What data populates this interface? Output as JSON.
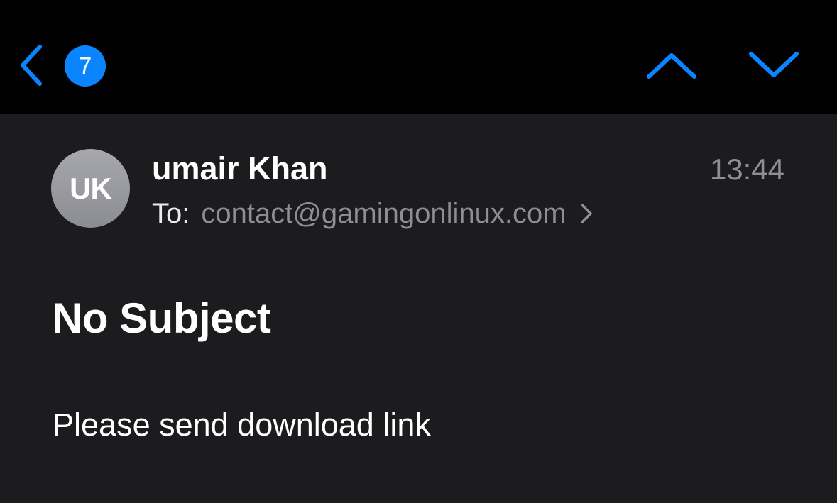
{
  "colors": {
    "accent": "#0a84ff",
    "navbar_bg": "#000000",
    "content_bg": "#1c1c1e",
    "secondary_text": "#8e8e93",
    "divider": "#38383a"
  },
  "navbar": {
    "back_icon": "chevron-left-icon",
    "unread_count": "7",
    "prev_icon": "chevron-up-icon",
    "next_icon": "chevron-down-icon"
  },
  "message": {
    "avatar_initials": "UK",
    "sender": "umair Khan",
    "time": "13:44",
    "to_label": "To:",
    "to_address": "contact@gamingonlinux.com",
    "recipient_icon": "chevron-right-icon",
    "subject": "No Subject",
    "body": "Please send download link"
  }
}
